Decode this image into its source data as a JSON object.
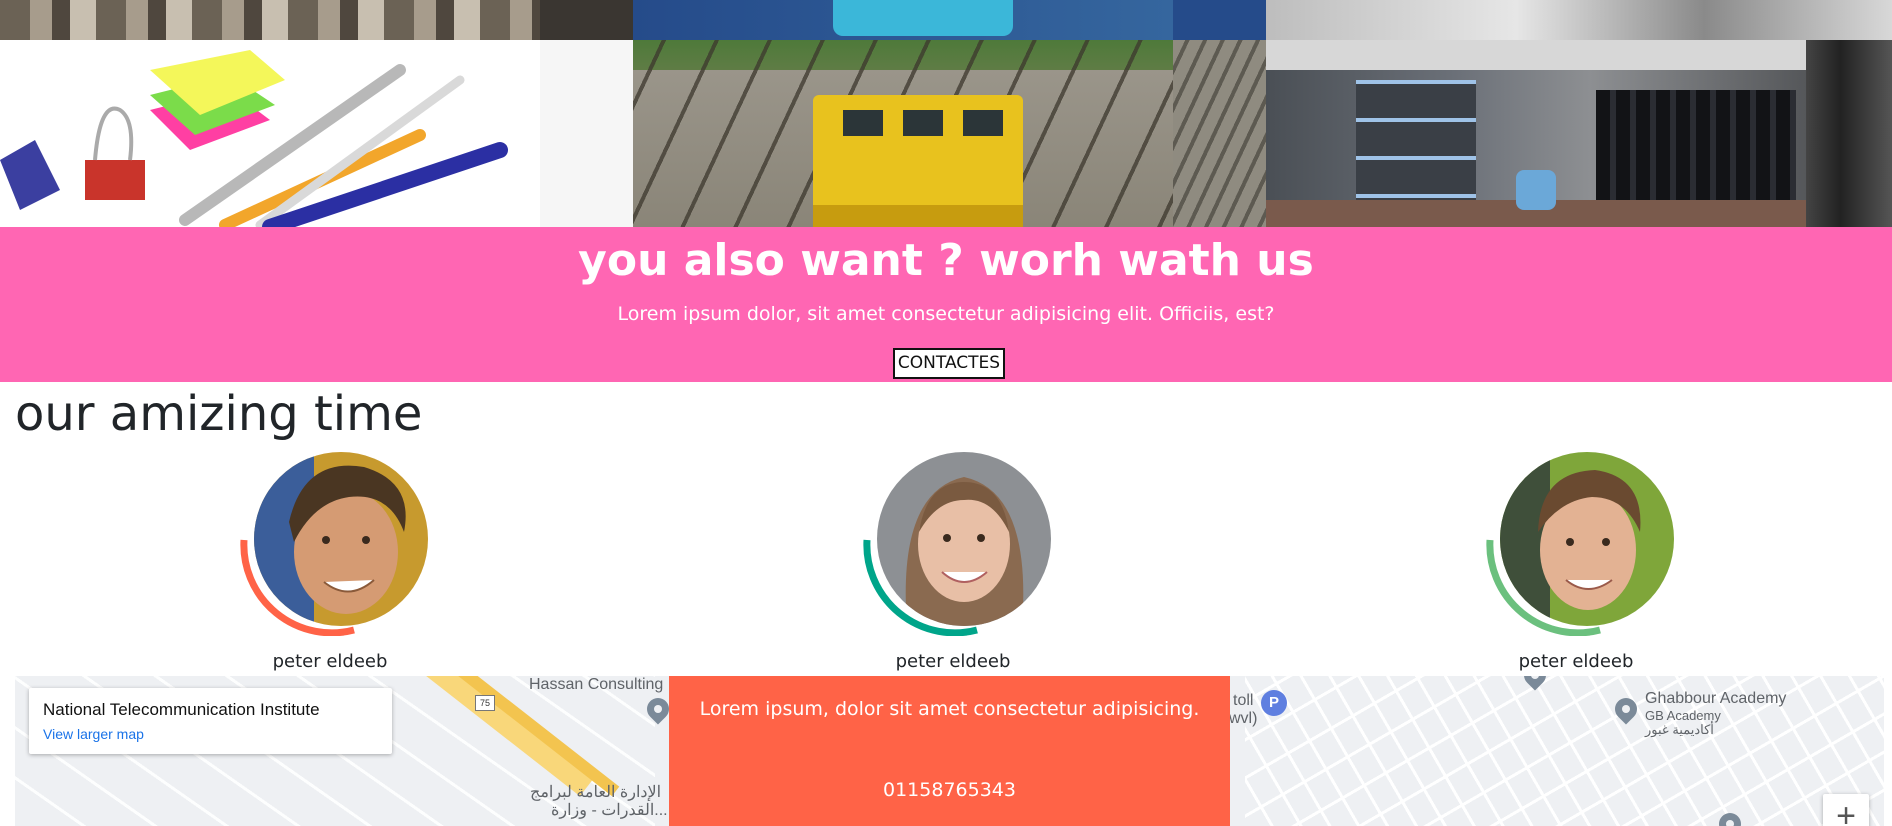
{
  "banner": {
    "title": "you also want ? worh wath us",
    "subtitle": "Lorem ipsum dolor, sit amet consectetur adipisicing elit. Officiis, est?",
    "button_label": "CONTACTES",
    "background": "#ff66b3"
  },
  "team": {
    "title": "our amizing time",
    "members": [
      {
        "name": "peter eldeeb",
        "ring_color": "#ff6347"
      },
      {
        "name": "peter eldeeb",
        "ring_color": "#00a58a"
      },
      {
        "name": "peter eldeeb",
        "ring_color": "#6bc07e"
      }
    ]
  },
  "map": {
    "card_title": "National Telecommunication Institute",
    "card_link": "View larger map",
    "labels": {
      "hassan": "Hassan Consulting",
      "route": "75",
      "arabic_line1": "الإدارة العامة لبرامج",
      "arabic_line2": "القدرات - وزارة...",
      "toll": "toll",
      "wvl": "wvl)",
      "parking": "P",
      "academy": "Ghabbour Academy",
      "academy_en": "GB Academy",
      "academy_ar": "أكاديمية غبور"
    },
    "zoom_in": "+"
  },
  "contact": {
    "text": "Lorem ipsum, dolor sit amet consectetur adipisicing.",
    "phone": "01158765343",
    "background": "#ff6347"
  }
}
